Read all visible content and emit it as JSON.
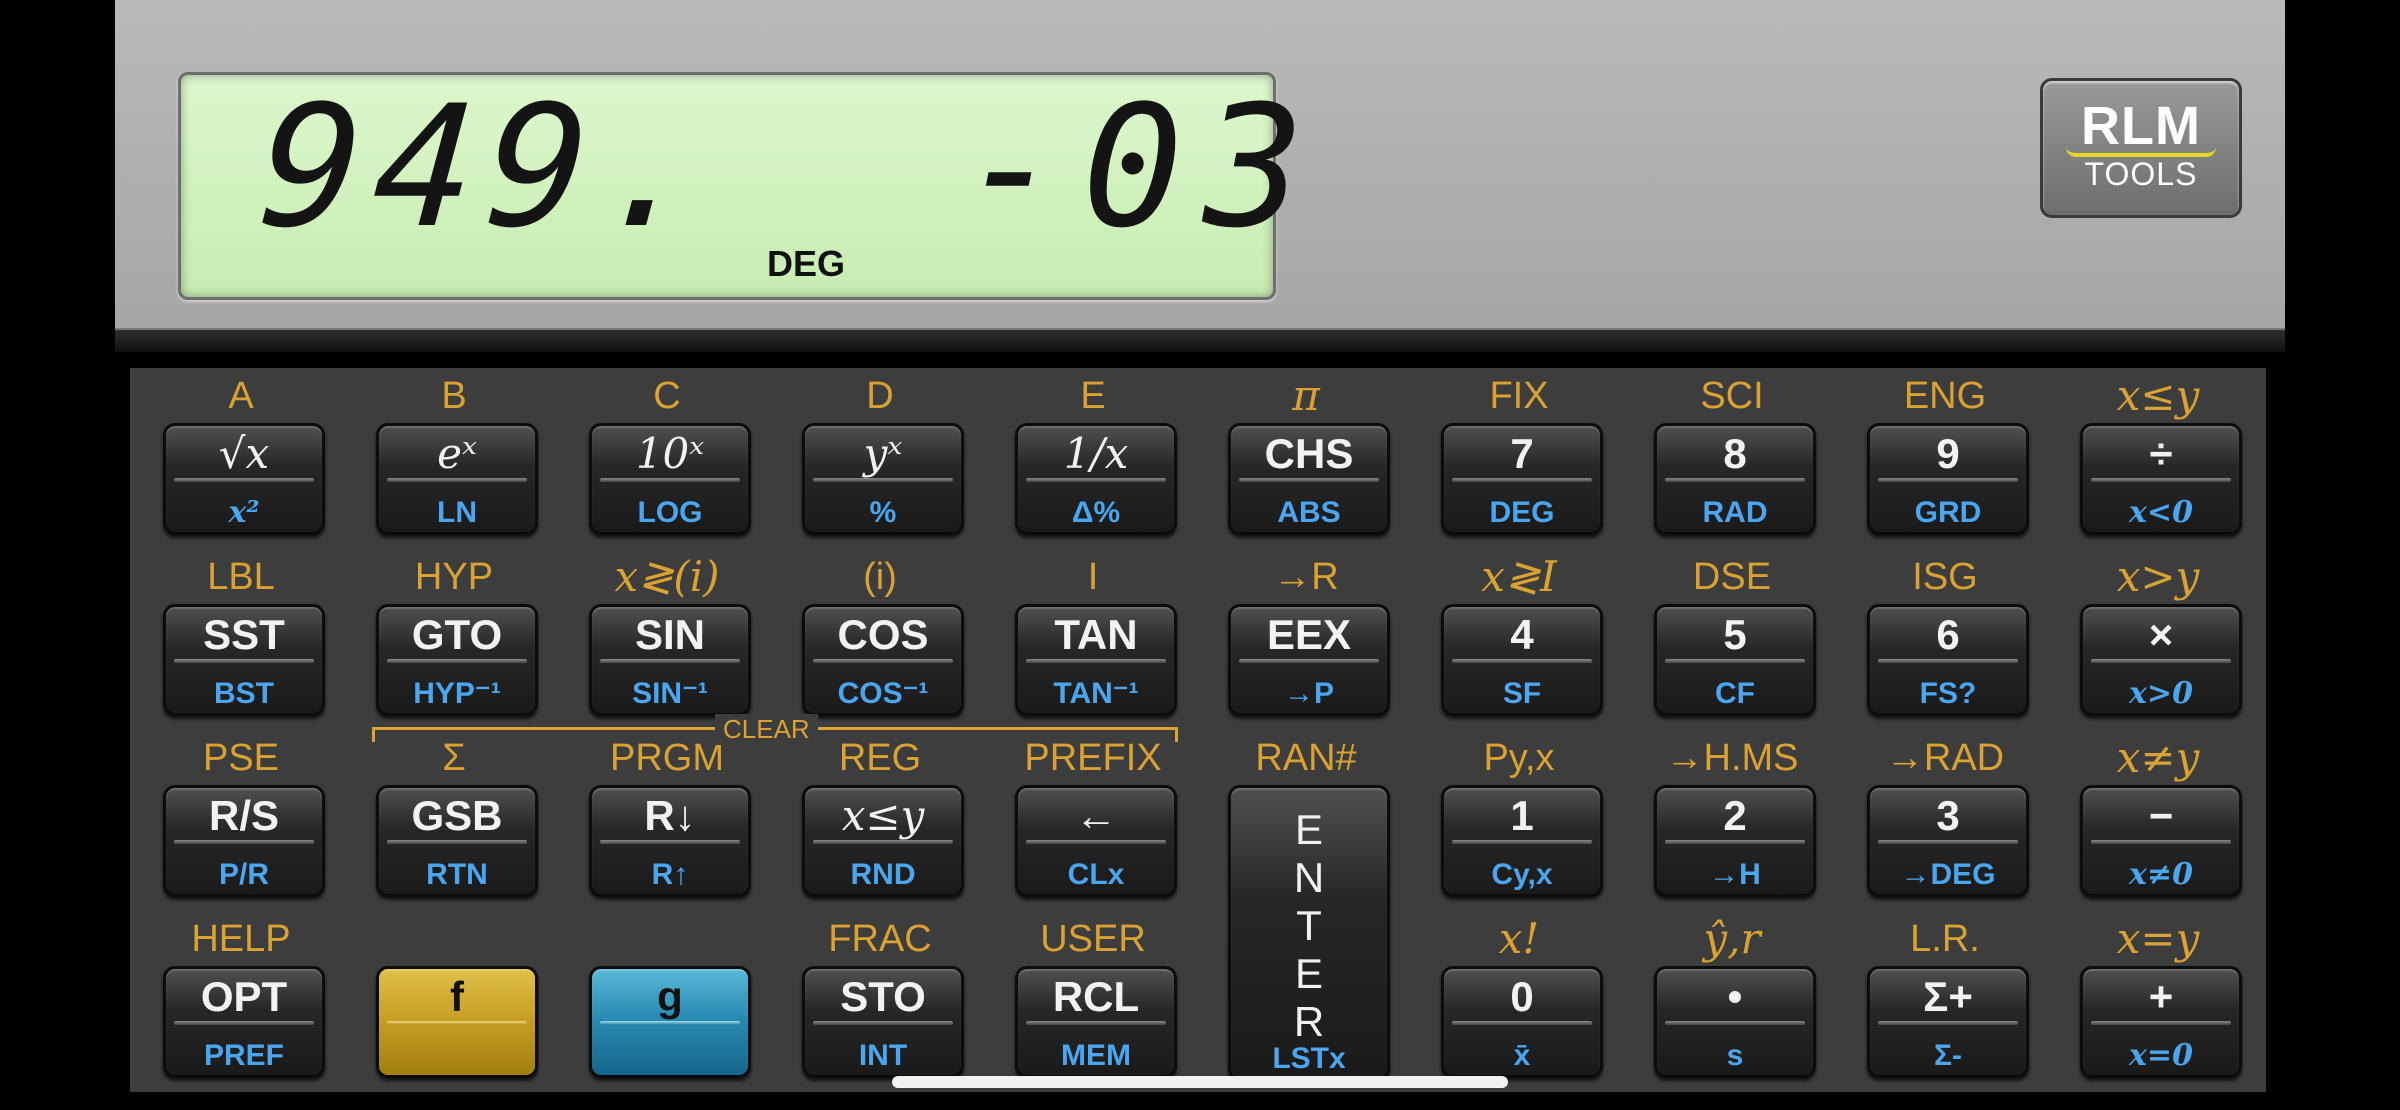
{
  "display": {
    "mantissa": "949.",
    "exponent": "-03",
    "mode": "DEG"
  },
  "logo": {
    "line1": "RLM",
    "line2": "TOOLS"
  },
  "clear_label": "CLEAR",
  "rows": [
    {
      "gold": [
        {
          "t": "A"
        },
        {
          "t": "B"
        },
        {
          "t": "C"
        },
        {
          "t": "D"
        },
        {
          "t": "E"
        },
        {
          "t": "π",
          "serif": true
        },
        {
          "t": "FIX"
        },
        {
          "t": "SCI"
        },
        {
          "t": "ENG"
        },
        {
          "t": "x≤y",
          "serif": true
        }
      ],
      "keys": [
        {
          "main": "√x",
          "blue": "x²",
          "mserif": true,
          "bserif": true
        },
        {
          "main": "eˣ",
          "blue": "LN",
          "mserif": true
        },
        {
          "main": "10ˣ",
          "blue": "LOG",
          "mserif": true
        },
        {
          "main": "yˣ",
          "blue": "%",
          "mserif": true
        },
        {
          "main": "1/x",
          "blue": "Δ%",
          "mserif": true
        },
        {
          "main": "CHS",
          "blue": "ABS"
        },
        {
          "main": "7",
          "blue": "DEG"
        },
        {
          "main": "8",
          "blue": "RAD"
        },
        {
          "main": "9",
          "blue": "GRD"
        },
        {
          "main": "÷",
          "blue": "x<0",
          "bserif": true
        }
      ]
    },
    {
      "gold": [
        {
          "t": "LBL"
        },
        {
          "t": "HYP"
        },
        {
          "t": "x≷(i)",
          "serif": true
        },
        {
          "t": "(i)"
        },
        {
          "t": "I"
        },
        {
          "t": "→R"
        },
        {
          "t": "x≷I",
          "serif": true
        },
        {
          "t": "DSE"
        },
        {
          "t": "ISG"
        },
        {
          "t": "x>y",
          "serif": true
        }
      ],
      "keys": [
        {
          "main": "SST",
          "blue": "BST"
        },
        {
          "main": "GTO",
          "blue": "HYP⁻¹"
        },
        {
          "main": "SIN",
          "blue": "SIN⁻¹"
        },
        {
          "main": "COS",
          "blue": "COS⁻¹"
        },
        {
          "main": "TAN",
          "blue": "TAN⁻¹"
        },
        {
          "main": "EEX",
          "blue": "→P"
        },
        {
          "main": "4",
          "blue": "SF"
        },
        {
          "main": "5",
          "blue": "CF"
        },
        {
          "main": "6",
          "blue": "FS?"
        },
        {
          "main": "×",
          "blue": "x>0",
          "bserif": true
        }
      ]
    },
    {
      "gold": [
        {
          "t": "PSE"
        },
        {
          "t": "Σ"
        },
        {
          "t": "PRGM"
        },
        {
          "t": "REG"
        },
        {
          "t": "PREFIX"
        },
        {
          "t": "RAN#"
        },
        {
          "t": "Py,x"
        },
        {
          "t": "→H.MS"
        },
        {
          "t": "→RAD"
        },
        {
          "t": "x≠y",
          "serif": true
        }
      ],
      "keys": [
        {
          "main": "R/S",
          "blue": "P/R"
        },
        {
          "main": "GSB",
          "blue": "RTN"
        },
        {
          "main": "R↓",
          "blue": "R↑"
        },
        {
          "main": "x≤y",
          "blue": "RND",
          "mserif": true
        },
        {
          "main": "←",
          "blue": "CLx"
        },
        {
          "main": "E N T E R",
          "blue": "LSTx",
          "enter": true
        },
        {
          "main": "1",
          "blue": "Cy,x"
        },
        {
          "main": "2",
          "blue": "→H"
        },
        {
          "main": "3",
          "blue": "→DEG"
        },
        {
          "main": "−",
          "blue": "x≠0",
          "bserif": true
        }
      ]
    },
    {
      "gold": [
        {
          "t": "HELP"
        },
        {
          "t": ""
        },
        {
          "t": ""
        },
        {
          "t": "FRAC"
        },
        {
          "t": "USER"
        },
        {
          "t": ""
        },
        {
          "t": "x!",
          "serif": true
        },
        {
          "t": "ŷ,r",
          "serif": true
        },
        {
          "t": "L.R."
        },
        {
          "t": "x=y",
          "serif": true
        }
      ],
      "keys": [
        {
          "main": "OPT",
          "blue": "PREF"
        },
        {
          "main": "f",
          "blue": "",
          "color": "f"
        },
        {
          "main": "g",
          "blue": "",
          "color": "g"
        },
        {
          "main": "STO",
          "blue": "INT"
        },
        {
          "main": "RCL",
          "blue": "MEM"
        },
        {
          "skip": true
        },
        {
          "main": "0",
          "blue": "x̄"
        },
        {
          "main": "•",
          "blue": "s"
        },
        {
          "main": "Σ+",
          "blue": "Σ-"
        },
        {
          "main": "+",
          "blue": "x=0",
          "bserif": true
        }
      ]
    }
  ]
}
